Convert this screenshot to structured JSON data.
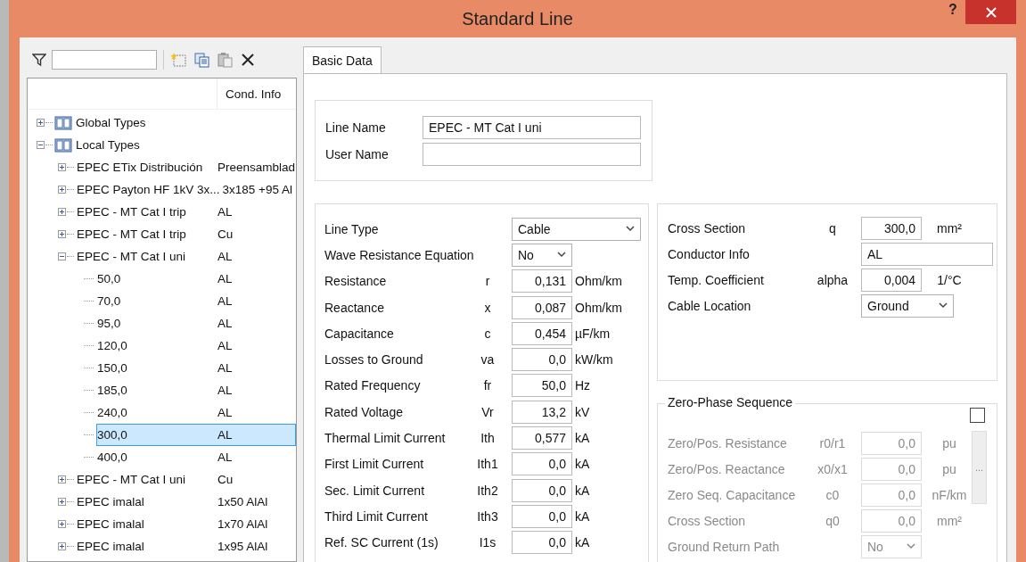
{
  "window": {
    "title": "Standard Line",
    "help": "?"
  },
  "tree": {
    "columns": [
      "Cond. Info"
    ],
    "items": [
      {
        "kind": "book",
        "label": "Global Types",
        "expanded": false,
        "selected": false
      },
      {
        "kind": "book",
        "label": "Local Types",
        "expanded": true,
        "selected": false,
        "children": [
          {
            "kind": "type",
            "label": "EPEC ETix Distribución",
            "info": "Preensamblad",
            "expanded": false,
            "selected": false
          },
          {
            "kind": "type",
            "label": "EPEC Payton HF 1kV 3x...",
            "info": "3x185 +95 Al",
            "expanded": false,
            "selected": false
          },
          {
            "kind": "type",
            "label": "EPEC - MT Cat I trip",
            "info": "AL",
            "expanded": false,
            "selected": false
          },
          {
            "kind": "type",
            "label": "EPEC - MT Cat I trip",
            "info": "Cu",
            "expanded": false,
            "selected": false
          },
          {
            "kind": "type",
            "label": "EPEC - MT Cat I uni",
            "info": "AL",
            "expanded": true,
            "selected": false,
            "children": [
              {
                "kind": "leaf",
                "label": "50,0",
                "info": "AL",
                "selected": false
              },
              {
                "kind": "leaf",
                "label": "70,0",
                "info": "AL",
                "selected": false
              },
              {
                "kind": "leaf",
                "label": "95,0",
                "info": "AL",
                "selected": false
              },
              {
                "kind": "leaf",
                "label": "120,0",
                "info": "AL",
                "selected": false
              },
              {
                "kind": "leaf",
                "label": "150,0",
                "info": "AL",
                "selected": false
              },
              {
                "kind": "leaf",
                "label": "185,0",
                "info": "AL",
                "selected": false
              },
              {
                "kind": "leaf",
                "label": "240,0",
                "info": "AL",
                "selected": false
              },
              {
                "kind": "leaf",
                "label": "300,0",
                "info": "AL",
                "selected": true
              },
              {
                "kind": "leaf",
                "label": "400,0",
                "info": "AL",
                "selected": false
              }
            ]
          },
          {
            "kind": "type",
            "label": "EPEC - MT Cat I uni",
            "info": "Cu",
            "expanded": false,
            "selected": false
          },
          {
            "kind": "type",
            "label": "EPEC imalal",
            "info": "1x50 AlAl",
            "expanded": false,
            "selected": false
          },
          {
            "kind": "type",
            "label": "EPEC imalal",
            "info": "1x70 AlAl",
            "expanded": false,
            "selected": false
          },
          {
            "kind": "type",
            "label": "EPEC imalal",
            "info": "1x95 AlAl",
            "expanded": false,
            "selected": false
          }
        ]
      }
    ]
  },
  "tabs": [
    {
      "label": "Basic Data",
      "selected": true
    }
  ],
  "names": [
    {
      "label": "Line Name",
      "value": "EPEC - MT Cat I uni"
    },
    {
      "label": "User Name"
    }
  ],
  "line_params": [
    {
      "kind": "select",
      "label": "Line Type",
      "value": "Cable"
    },
    {
      "kind": "select",
      "label": "Wave Resistance Equation",
      "value": "No"
    },
    {
      "kind": "number",
      "label": "Resistance",
      "symbol": "r",
      "value": "0,131",
      "unit": "Ohm/km"
    },
    {
      "kind": "number",
      "label": "Reactance",
      "symbol": "x",
      "value": "0,087",
      "unit": "Ohm/km"
    },
    {
      "kind": "number",
      "label": "Capacitance",
      "symbol": "c",
      "value": "0,454",
      "unit": "µF/km"
    },
    {
      "kind": "number",
      "label": "Losses to Ground",
      "symbol": "va",
      "value": "0,0",
      "unit": "kW/km"
    },
    {
      "kind": "number",
      "label": "Rated Frequency",
      "symbol": "fr",
      "value": "50,0",
      "unit": "Hz"
    },
    {
      "kind": "number",
      "label": "Rated Voltage",
      "symbol": "Vr",
      "value": "13,2",
      "unit": "kV"
    },
    {
      "kind": "number",
      "label": "Thermal Limit Current",
      "symbol": "Ith",
      "value": "0,577",
      "unit": "kA"
    },
    {
      "kind": "number",
      "label": "First Limit Current",
      "symbol": "Ith1",
      "value": "0,0",
      "unit": "kA"
    },
    {
      "kind": "number",
      "label": "Sec. Limit Current",
      "symbol": "Ith2",
      "value": "0,0",
      "unit": "kA"
    },
    {
      "kind": "number",
      "label": "Third Limit Current",
      "symbol": "Ith3",
      "value": "0,0",
      "unit": "kA"
    },
    {
      "kind": "number",
      "label": "Ref. SC Current (1s)",
      "symbol": "I1s",
      "value": "0,0",
      "unit": "kA"
    }
  ],
  "conductor_params": [
    {
      "kind": "number",
      "label": "Cross Section",
      "symbol": "q",
      "value": "300,0",
      "unit": "mm²"
    },
    {
      "kind": "text",
      "label": "Conductor Info",
      "value": "AL"
    },
    {
      "kind": "number",
      "label": "Temp. Coefficient",
      "symbol": "alpha",
      "value": "0,004",
      "unit": "1/°C"
    },
    {
      "kind": "select",
      "label": "Cable Location",
      "value": "Ground"
    }
  ],
  "zero_phase": {
    "title": "Zero-Phase Sequence",
    "checked": false,
    "more_button": "...",
    "params": [
      {
        "kind": "number",
        "label": "Zero/Pos. Resistance",
        "symbol": "r0/r1",
        "value": "0,0",
        "unit": "pu"
      },
      {
        "kind": "number",
        "label": "Zero/Pos. Reactance",
        "symbol": "x0/x1",
        "value": "0,0",
        "unit": "pu"
      },
      {
        "kind": "number",
        "label": "Zero Seq. Capacitance",
        "symbol": "c0",
        "value": "0,0",
        "unit": "nF/km"
      },
      {
        "kind": "number",
        "label": "Cross Section",
        "symbol": "q0",
        "value": "0,0",
        "unit": "mm²"
      },
      {
        "kind": "select",
        "label": "Ground Return Path",
        "value": "No"
      }
    ]
  }
}
